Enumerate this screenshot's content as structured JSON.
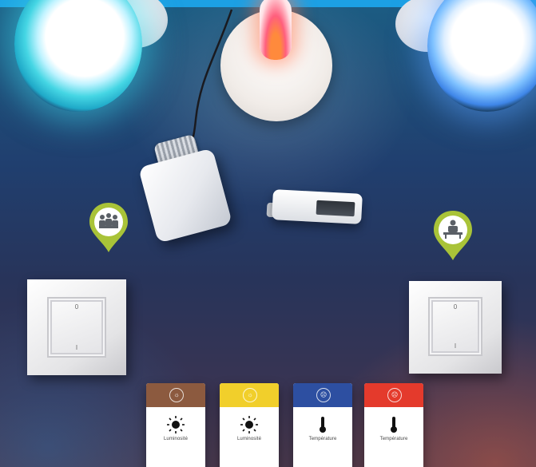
{
  "scene": {
    "switch_left": {
      "top_mark": "0",
      "bottom_mark": "I"
    },
    "switch_right": {
      "top_mark": "0",
      "bottom_mark": "I"
    },
    "pins": [
      {
        "icon": "meeting-room-icon",
        "color": "#a9c338"
      },
      {
        "icon": "desk-icon",
        "color": "#a9c338"
      }
    ],
    "cards": [
      {
        "band_color": "#8c5a3f",
        "band_icon": "sun-icon",
        "icon": "sun-icon",
        "title": "Luminosité"
      },
      {
        "band_color": "#f1cf2b",
        "band_icon": "sun-icon",
        "icon": "sun-icon",
        "title": "Luminosité"
      },
      {
        "band_color": "#2d4fa1",
        "band_icon": "thermometer-icon",
        "icon": "thermometer-icon",
        "title": "Température"
      },
      {
        "band_color": "#e43a2c",
        "band_icon": "thermometer-icon",
        "icon": "thermometer-icon",
        "title": "Température"
      }
    ]
  }
}
